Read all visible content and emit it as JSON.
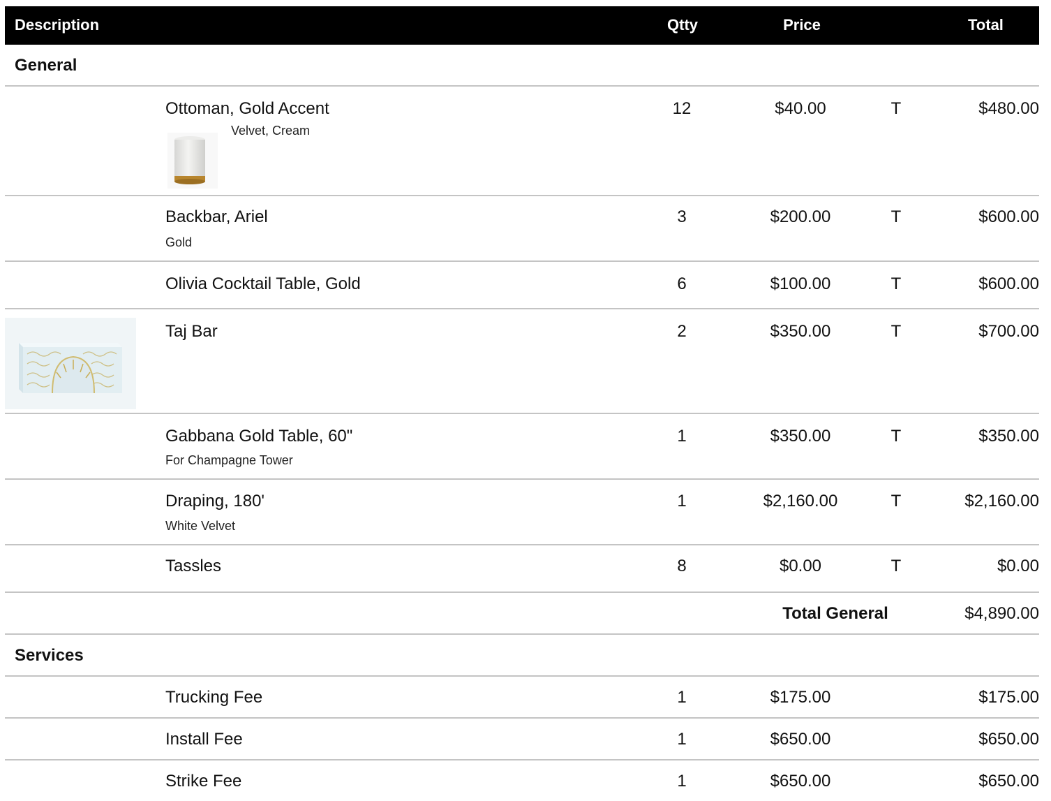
{
  "header": {
    "description": "Description",
    "qty": "Qtty",
    "price": "Price",
    "total": "Total"
  },
  "sections": [
    {
      "title": "General",
      "items": [
        {
          "name": "Ottoman, Gold Accent",
          "note": "Velvet, Cream",
          "qty": "12",
          "price": "$40.00",
          "tax": "T",
          "total": "$480.00",
          "image": "ottoman-thumbnail"
        },
        {
          "name": "Backbar, Ariel",
          "note": "Gold",
          "qty": "3",
          "price": "$200.00",
          "tax": "T",
          "total": "$600.00"
        },
        {
          "name": "Olivia Cocktail Table, Gold",
          "note": "",
          "qty": "6",
          "price": "$100.00",
          "tax": "T",
          "total": "$600.00"
        },
        {
          "name": "Taj Bar",
          "note": "",
          "qty": "2",
          "price": "$350.00",
          "tax": "T",
          "total": "$700.00",
          "image": "taj-bar-thumbnail"
        },
        {
          "name": "Gabbana Gold Table, 60\"",
          "note": "For Champagne Tower",
          "qty": "1",
          "price": "$350.00",
          "tax": "T",
          "total": "$350.00"
        },
        {
          "name": "Draping, 180'",
          "note": "White Velvet",
          "qty": "1",
          "price": "$2,160.00",
          "tax": "T",
          "total": "$2,160.00"
        },
        {
          "name": "Tassles",
          "note": "",
          "qty": "8",
          "price": "$0.00",
          "tax": "T",
          "total": "$0.00"
        }
      ],
      "subtotal_label": "Total General",
      "subtotal_value": "$4,890.00"
    },
    {
      "title": "Services",
      "items": [
        {
          "name": "Trucking Fee",
          "note": "",
          "qty": "1",
          "price": "$175.00",
          "tax": "",
          "total": "$175.00"
        },
        {
          "name": "Install Fee",
          "note": "",
          "qty": "1",
          "price": "$650.00",
          "tax": "",
          "total": "$650.00"
        },
        {
          "name": "Strike Fee",
          "note": "",
          "qty": "1",
          "price": "$650.00",
          "tax": "",
          "total": "$650.00"
        }
      ]
    }
  ]
}
